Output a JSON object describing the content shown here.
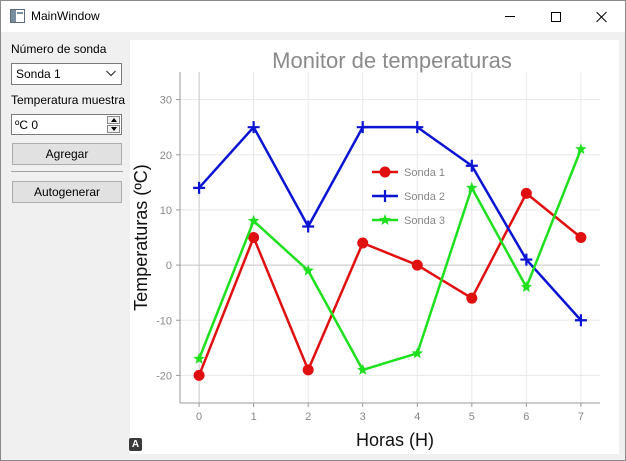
{
  "window": {
    "title": "MainWindow"
  },
  "sidebar": {
    "probe_label": "Número de sonda",
    "probe_selected": "Sonda 1",
    "temp_label": "Temperatura muestra",
    "temp_value": "ºC 0",
    "add_button": "Agregar",
    "autogen_button": "Autogenerar"
  },
  "chart_data": {
    "type": "line",
    "title": "Monitor de temperaturas",
    "xlabel": "Horas (H)",
    "ylabel": "Temperaturas (ºC)",
    "x": [
      0,
      1,
      2,
      3,
      4,
      5,
      6,
      7
    ],
    "xlim": [
      -0.35,
      7.35
    ],
    "ylim": [
      -25,
      35
    ],
    "xticks": [
      0,
      1,
      2,
      3,
      4,
      5,
      6,
      7
    ],
    "yticks": [
      -20,
      -10,
      0,
      10,
      20,
      30
    ],
    "grid": true,
    "legend_position": "center",
    "series": [
      {
        "name": "Sonda 1",
        "color": "#e01010",
        "marker": "circle",
        "values": [
          -20,
          5,
          -19,
          4,
          0,
          -6,
          13,
          5
        ]
      },
      {
        "name": "Sonda 2",
        "color": "#0a14d2",
        "marker": "plus",
        "values": [
          14,
          25,
          7,
          25,
          25,
          18,
          1,
          -10
        ]
      },
      {
        "name": "Sonda 3",
        "color": "#1ee01e",
        "marker": "star",
        "values": [
          -17,
          8,
          -1,
          -19,
          -16,
          14,
          -4,
          21
        ]
      }
    ],
    "colors": {
      "title": "#8a8a8a",
      "ticks": "#888888",
      "legend_text": "#888888",
      "axis": "#999999",
      "grid": "#e8e8e8"
    }
  }
}
